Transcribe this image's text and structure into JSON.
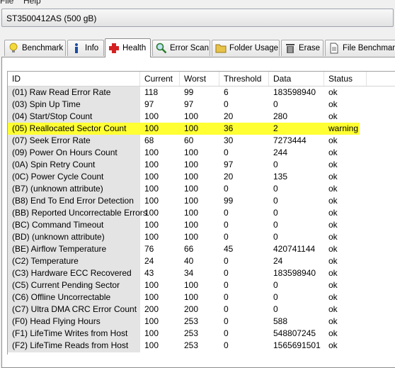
{
  "menu": [
    "File",
    "Help"
  ],
  "drive": {
    "label": "ST3500412AS (500 gB)"
  },
  "tabs": [
    {
      "label": "Benchmark",
      "icon": "lightbulb-icon",
      "active": false
    },
    {
      "label": "Info",
      "icon": "info-icon",
      "active": false
    },
    {
      "label": "Health",
      "icon": "health-cross-icon",
      "active": true
    },
    {
      "label": "Error Scan",
      "icon": "magnifier-icon",
      "active": false
    },
    {
      "label": "Folder Usage",
      "icon": "folder-icon",
      "active": false
    },
    {
      "label": "Erase",
      "icon": "trash-icon",
      "active": false
    },
    {
      "label": "File Benchmark",
      "icon": "document-icon",
      "active": false
    }
  ],
  "columns": [
    "ID",
    "Current",
    "Worst",
    "Threshold",
    "Data",
    "Status"
  ],
  "rows": [
    {
      "id": "(01) Raw Read Error Rate",
      "current": "118",
      "worst": "99",
      "threshold": "6",
      "data": "183598940",
      "status": "ok"
    },
    {
      "id": "(03) Spin Up Time",
      "current": "97",
      "worst": "97",
      "threshold": "0",
      "data": "0",
      "status": "ok"
    },
    {
      "id": "(04) Start/Stop Count",
      "current": "100",
      "worst": "100",
      "threshold": "20",
      "data": "280",
      "status": "ok"
    },
    {
      "id": "(05) Reallocated Sector Count",
      "current": "100",
      "worst": "100",
      "threshold": "36",
      "data": "2",
      "status": "warning"
    },
    {
      "id": "(07) Seek Error Rate",
      "current": "68",
      "worst": "60",
      "threshold": "30",
      "data": "7273444",
      "status": "ok"
    },
    {
      "id": "(09) Power On Hours Count",
      "current": "100",
      "worst": "100",
      "threshold": "0",
      "data": "244",
      "status": "ok"
    },
    {
      "id": "(0A) Spin Retry Count",
      "current": "100",
      "worst": "100",
      "threshold": "97",
      "data": "0",
      "status": "ok"
    },
    {
      "id": "(0C) Power Cycle Count",
      "current": "100",
      "worst": "100",
      "threshold": "20",
      "data": "135",
      "status": "ok"
    },
    {
      "id": "(B7) (unknown attribute)",
      "current": "100",
      "worst": "100",
      "threshold": "0",
      "data": "0",
      "status": "ok"
    },
    {
      "id": "(B8) End To End Error Detection",
      "current": "100",
      "worst": "100",
      "threshold": "99",
      "data": "0",
      "status": "ok"
    },
    {
      "id": "(BB) Reported Uncorrectable Errors",
      "current": "100",
      "worst": "100",
      "threshold": "0",
      "data": "0",
      "status": "ok"
    },
    {
      "id": "(BC) Command Timeout",
      "current": "100",
      "worst": "100",
      "threshold": "0",
      "data": "0",
      "status": "ok"
    },
    {
      "id": "(BD) (unknown attribute)",
      "current": "100",
      "worst": "100",
      "threshold": "0",
      "data": "0",
      "status": "ok"
    },
    {
      "id": "(BE) Airflow Temperature",
      "current": "76",
      "worst": "66",
      "threshold": "45",
      "data": "420741144",
      "status": "ok"
    },
    {
      "id": "(C2) Temperature",
      "current": "24",
      "worst": "40",
      "threshold": "0",
      "data": "24",
      "status": "ok"
    },
    {
      "id": "(C3) Hardware ECC Recovered",
      "current": "43",
      "worst": "34",
      "threshold": "0",
      "data": "183598940",
      "status": "ok"
    },
    {
      "id": "(C5) Current Pending Sector",
      "current": "100",
      "worst": "100",
      "threshold": "0",
      "data": "0",
      "status": "ok"
    },
    {
      "id": "(C6) Offline Uncorrectable",
      "current": "100",
      "worst": "100",
      "threshold": "0",
      "data": "0",
      "status": "ok"
    },
    {
      "id": "(C7) Ultra DMA CRC Error Count",
      "current": "200",
      "worst": "200",
      "threshold": "0",
      "data": "0",
      "status": "ok"
    },
    {
      "id": "(F0) Head Flying Hours",
      "current": "100",
      "worst": "253",
      "threshold": "0",
      "data": "588",
      "status": "ok"
    },
    {
      "id": "(F1) LifeTime Writes from Host",
      "current": "100",
      "worst": "253",
      "threshold": "0",
      "data": "548807245",
      "status": "ok"
    },
    {
      "id": "(F2) LifeTime Reads from Host",
      "current": "100",
      "worst": "253",
      "threshold": "0",
      "data": "1565691501",
      "status": "ok"
    }
  ],
  "colors": {
    "warning_highlight": "#ffff33",
    "id_column_bg": "#e4e4e4"
  }
}
